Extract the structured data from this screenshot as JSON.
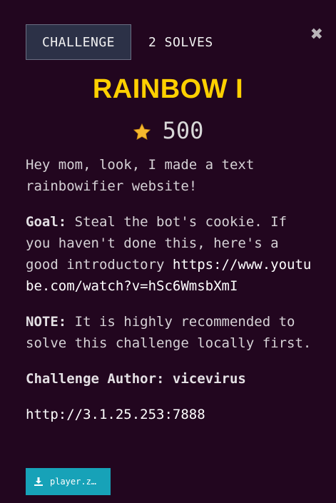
{
  "tabs": {
    "challenge_label": "CHALLENGE",
    "solves_label": "2 SOLVES"
  },
  "close": {
    "icon": "close-icon",
    "glyph": "✖"
  },
  "challenge": {
    "title": "RAINBOW I",
    "points": "500",
    "description_line": "Hey mom, look, I made a text rainbowifier website!",
    "goal_label": "Goal:",
    "goal_text": " Steal the bot's cookie. If you haven't done this, here's a good introductory ",
    "goal_link": "https://www.youtube.com/watch?v=hSc6WmsbXmI",
    "note_label": "NOTE:",
    "note_text": " It is highly recommended to solve this challenge locally first.",
    "author_label": "Challenge Author: ",
    "author_name": "vicevirus",
    "url": "http://3.1.25.253:7888"
  },
  "download": {
    "label": "player.z…",
    "icon": "download-icon"
  },
  "colors": {
    "background": "#22061f",
    "title": "#ffd000",
    "star": "#f5b82e",
    "tab_active_bg": "#2c3147",
    "download_bg": "#17a2b8"
  }
}
